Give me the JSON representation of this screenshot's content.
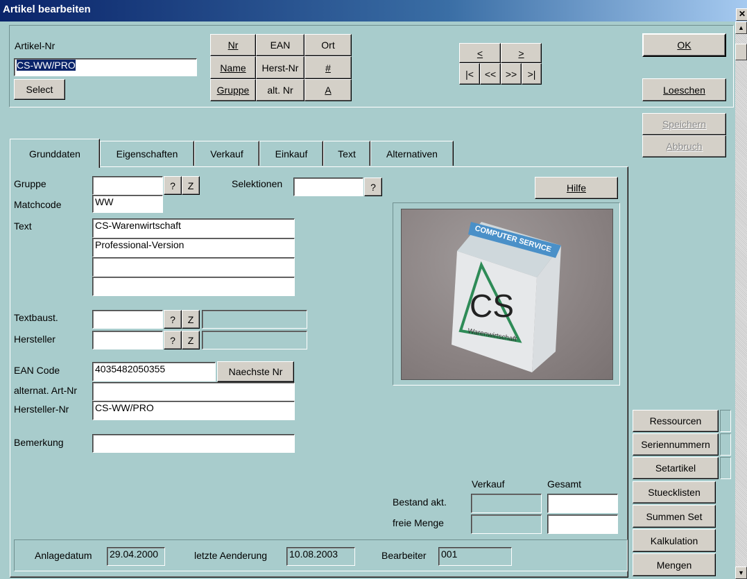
{
  "window": {
    "title": "Artikel bearbeiten",
    "close_glyph": "✕"
  },
  "header": {
    "artikel_nr_label": "Artikel-Nr",
    "artikel_nr_value": "CS-WW/PRO",
    "select_label": "Select",
    "search_buttons": {
      "nr": "Nr",
      "ean": "EAN",
      "ort": "Ort",
      "name": "Name",
      "herst_nr": "Herst-Nr",
      "hash": "#",
      "gruppe": "Gruppe",
      "alt_nr": "alt. Nr",
      "a": "A"
    },
    "nav_buttons": {
      "prev": "<",
      "next": ">",
      "first": "|<",
      "prev_page": "<<",
      "next_page": ">>",
      "last": ">|"
    }
  },
  "actions": {
    "ok": "OK",
    "loeschen": "Loeschen",
    "speichern": "Speichern",
    "abbruch": "Abbruch"
  },
  "tabs": [
    "Grunddaten",
    "Eigenschaften",
    "Verkauf",
    "Einkauf",
    "Text",
    "Alternativen"
  ],
  "form": {
    "gruppe_label": "Gruppe",
    "gruppe_value": "",
    "selektionen_label": "Selektionen",
    "selektionen_value": "",
    "matchcode_label": "Matchcode",
    "matchcode_value": "WW",
    "text_label": "Text",
    "text_lines": [
      "CS-Warenwirtschaft",
      "Professional-Version",
      "",
      ""
    ],
    "textbaust_label": "Textbaust.",
    "hersteller_label": "Hersteller",
    "ean_label": "EAN Code",
    "ean_value": "4035482050355",
    "naechste_nr": "Naechste Nr",
    "alt_art_nr_label": "alternat. Art-Nr",
    "alt_art_nr_value": "",
    "hersteller_nr_label": "Hersteller-Nr",
    "hersteller_nr_value": "CS-WW/PRO",
    "bemerkung_label": "Bemerkung",
    "bemerkung_value": "",
    "q": "?",
    "z": "Z",
    "hilfe": "Hilfe"
  },
  "image_box": {
    "box_brand": "COMPUTER SERVICE",
    "box_logo": "CS",
    "box_subtext": "Warenwirtschaft"
  },
  "stock": {
    "verkauf_header": "Verkauf",
    "gesamt_header": "Gesamt",
    "bestand_label": "Bestand akt.",
    "freie_menge_label": "freie Menge",
    "bestand_verkauf": "",
    "bestand_gesamt": "",
    "freie_verkauf": "",
    "freie_gesamt": ""
  },
  "footer": {
    "anlagedatum_label": "Anlagedatum",
    "anlagedatum_value": "29.04.2000",
    "letzte_label": "letzte Aenderung",
    "letzte_value": "10.08.2003",
    "bearbeiter_label": "Bearbeiter",
    "bearbeiter_value": "001"
  },
  "side_buttons": [
    "Ressourcen",
    "Seriennummern",
    "Setartikel",
    "Stuecklisten",
    "Summen Set",
    "Kalkulation",
    "Mengen"
  ]
}
